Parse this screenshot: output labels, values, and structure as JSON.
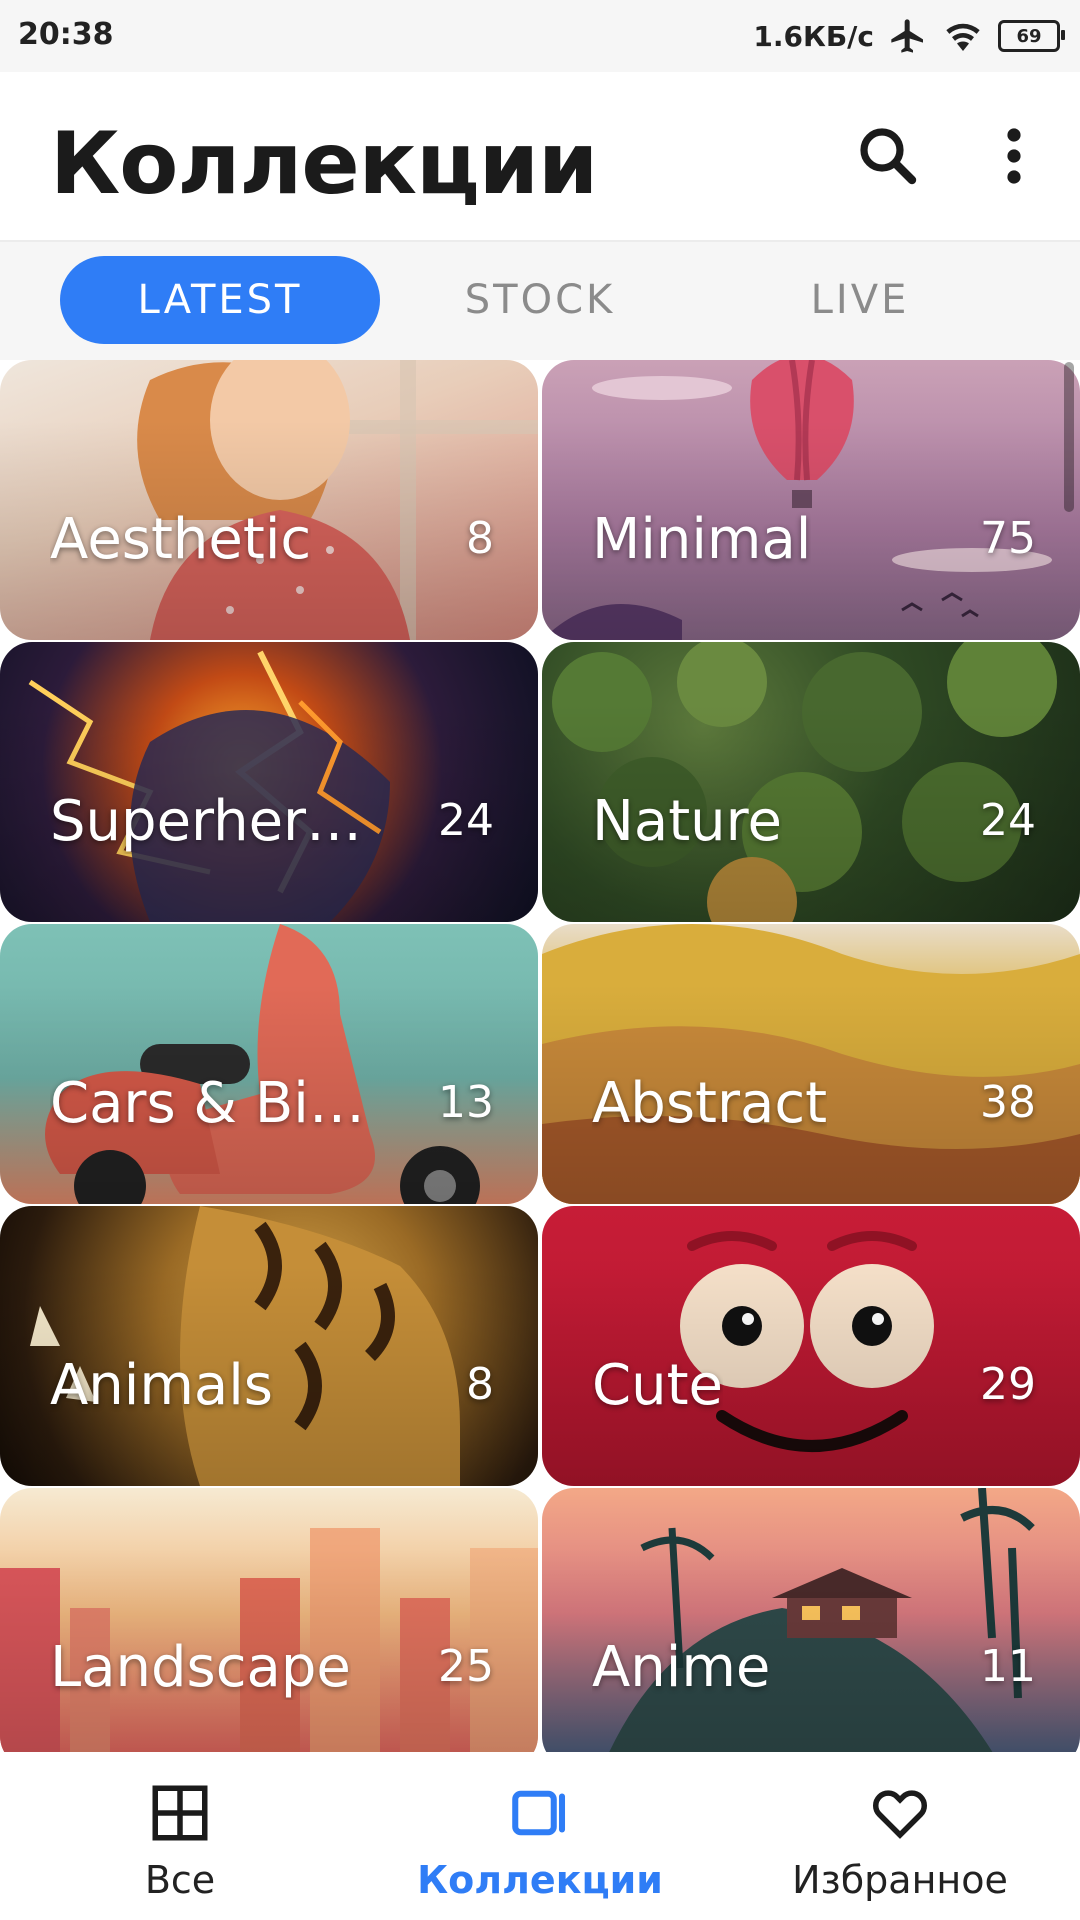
{
  "status_bar": {
    "time": "20:38",
    "network_speed": "1.6КБ/с",
    "battery": "69",
    "icons": [
      "airplane-icon",
      "wifi-icon",
      "battery-icon"
    ]
  },
  "header": {
    "title": "Коллекции",
    "actions": [
      "search-icon",
      "more-vert-icon"
    ]
  },
  "tabs": [
    {
      "label": "LATEST",
      "active": true
    },
    {
      "label": "STOCK",
      "active": false
    },
    {
      "label": "LIVE",
      "active": false
    }
  ],
  "collections": [
    {
      "label": "Aesthetic",
      "count": "8"
    },
    {
      "label": "Minimal",
      "count": "75"
    },
    {
      "label": "Superher…",
      "count": "24"
    },
    {
      "label": "Nature",
      "count": "24"
    },
    {
      "label": "Cars & Bi…",
      "count": "13"
    },
    {
      "label": "Abstract",
      "count": "38"
    },
    {
      "label": "Animals",
      "count": "8"
    },
    {
      "label": "Cute",
      "count": "29"
    },
    {
      "label": "Landscape",
      "count": "25"
    },
    {
      "label": "Anime",
      "count": "11"
    }
  ],
  "bottom_nav": [
    {
      "label": "Все",
      "icon": "grid-icon",
      "active": false
    },
    {
      "label": "Коллекции",
      "icon": "collections-icon",
      "active": true
    },
    {
      "label": "Избранное",
      "icon": "heart-icon",
      "active": false
    }
  ],
  "colors": {
    "accent": "#2f7df6",
    "tab_bar_bg": "#f6f6f6",
    "title_text": "#1b1b1b"
  }
}
